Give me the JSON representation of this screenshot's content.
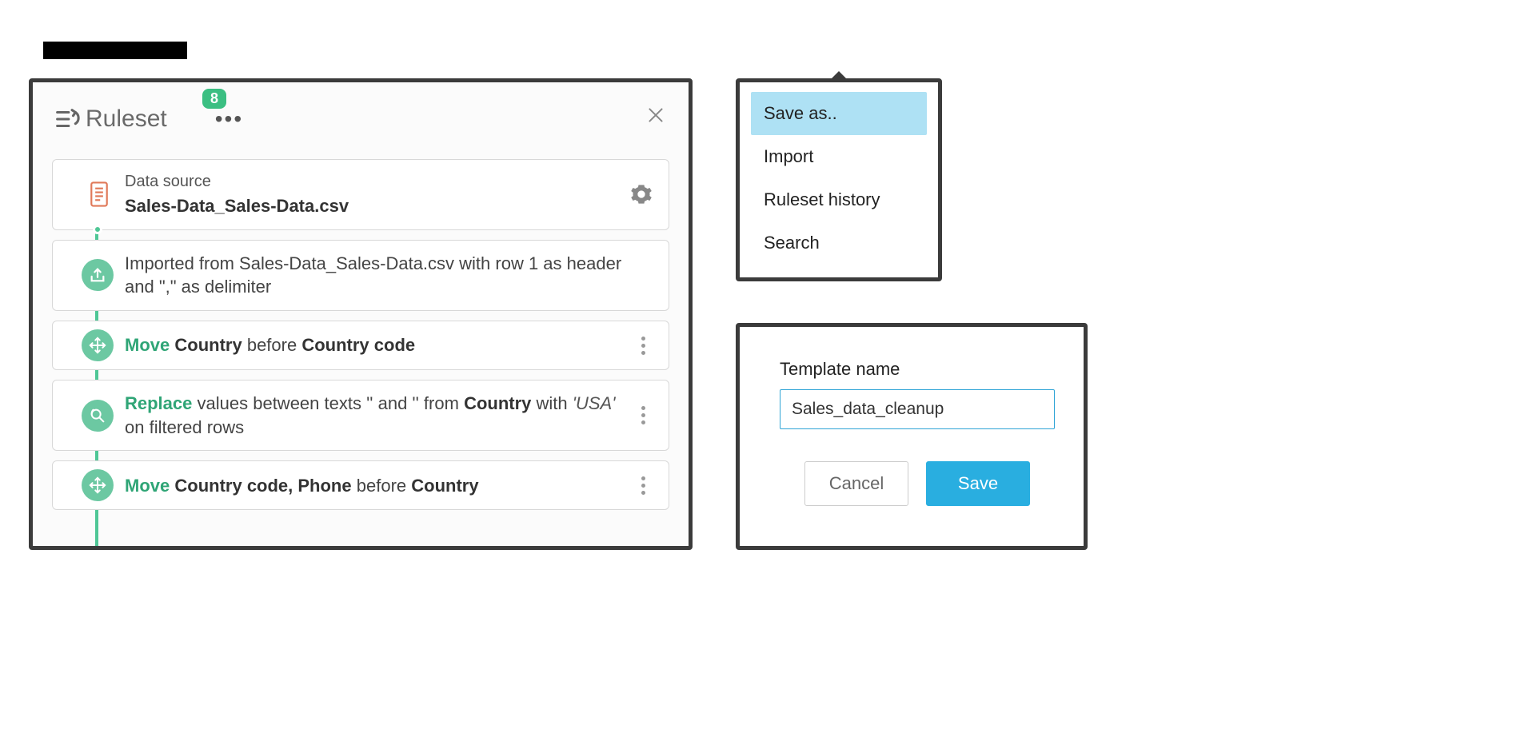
{
  "ruleset": {
    "title": "Ruleset",
    "badge": "8",
    "data_source": {
      "label": "Data source",
      "filename": "Sales-Data_Sales-Data.csv"
    },
    "steps": [
      {
        "type": "import",
        "text_prefix": "Imported from Sales-Data_Sales-Data.csv with row 1 as header and \",\" as delimiter"
      },
      {
        "type": "move",
        "action": "Move",
        "cols": "Country",
        "rel": "before",
        "target": "Country code"
      },
      {
        "type": "replace",
        "action": "Replace",
        "mid1": "values between texts '' and '' from",
        "col": "Country",
        "mid2": "with",
        "value": "'USA'",
        "suffix": "on filtered rows"
      },
      {
        "type": "move",
        "action": "Move",
        "cols": "Country code, Phone",
        "rel": "before",
        "target": "Country"
      }
    ]
  },
  "menu": {
    "items": [
      {
        "label": "Save as..",
        "highlight": true
      },
      {
        "label": "Import",
        "highlight": false
      },
      {
        "label": "Ruleset history",
        "highlight": false
      },
      {
        "label": "Search",
        "highlight": false
      }
    ]
  },
  "dialog": {
    "label": "Template name",
    "value": "Sales_data_cleanup",
    "cancel": "Cancel",
    "save": "Save"
  }
}
